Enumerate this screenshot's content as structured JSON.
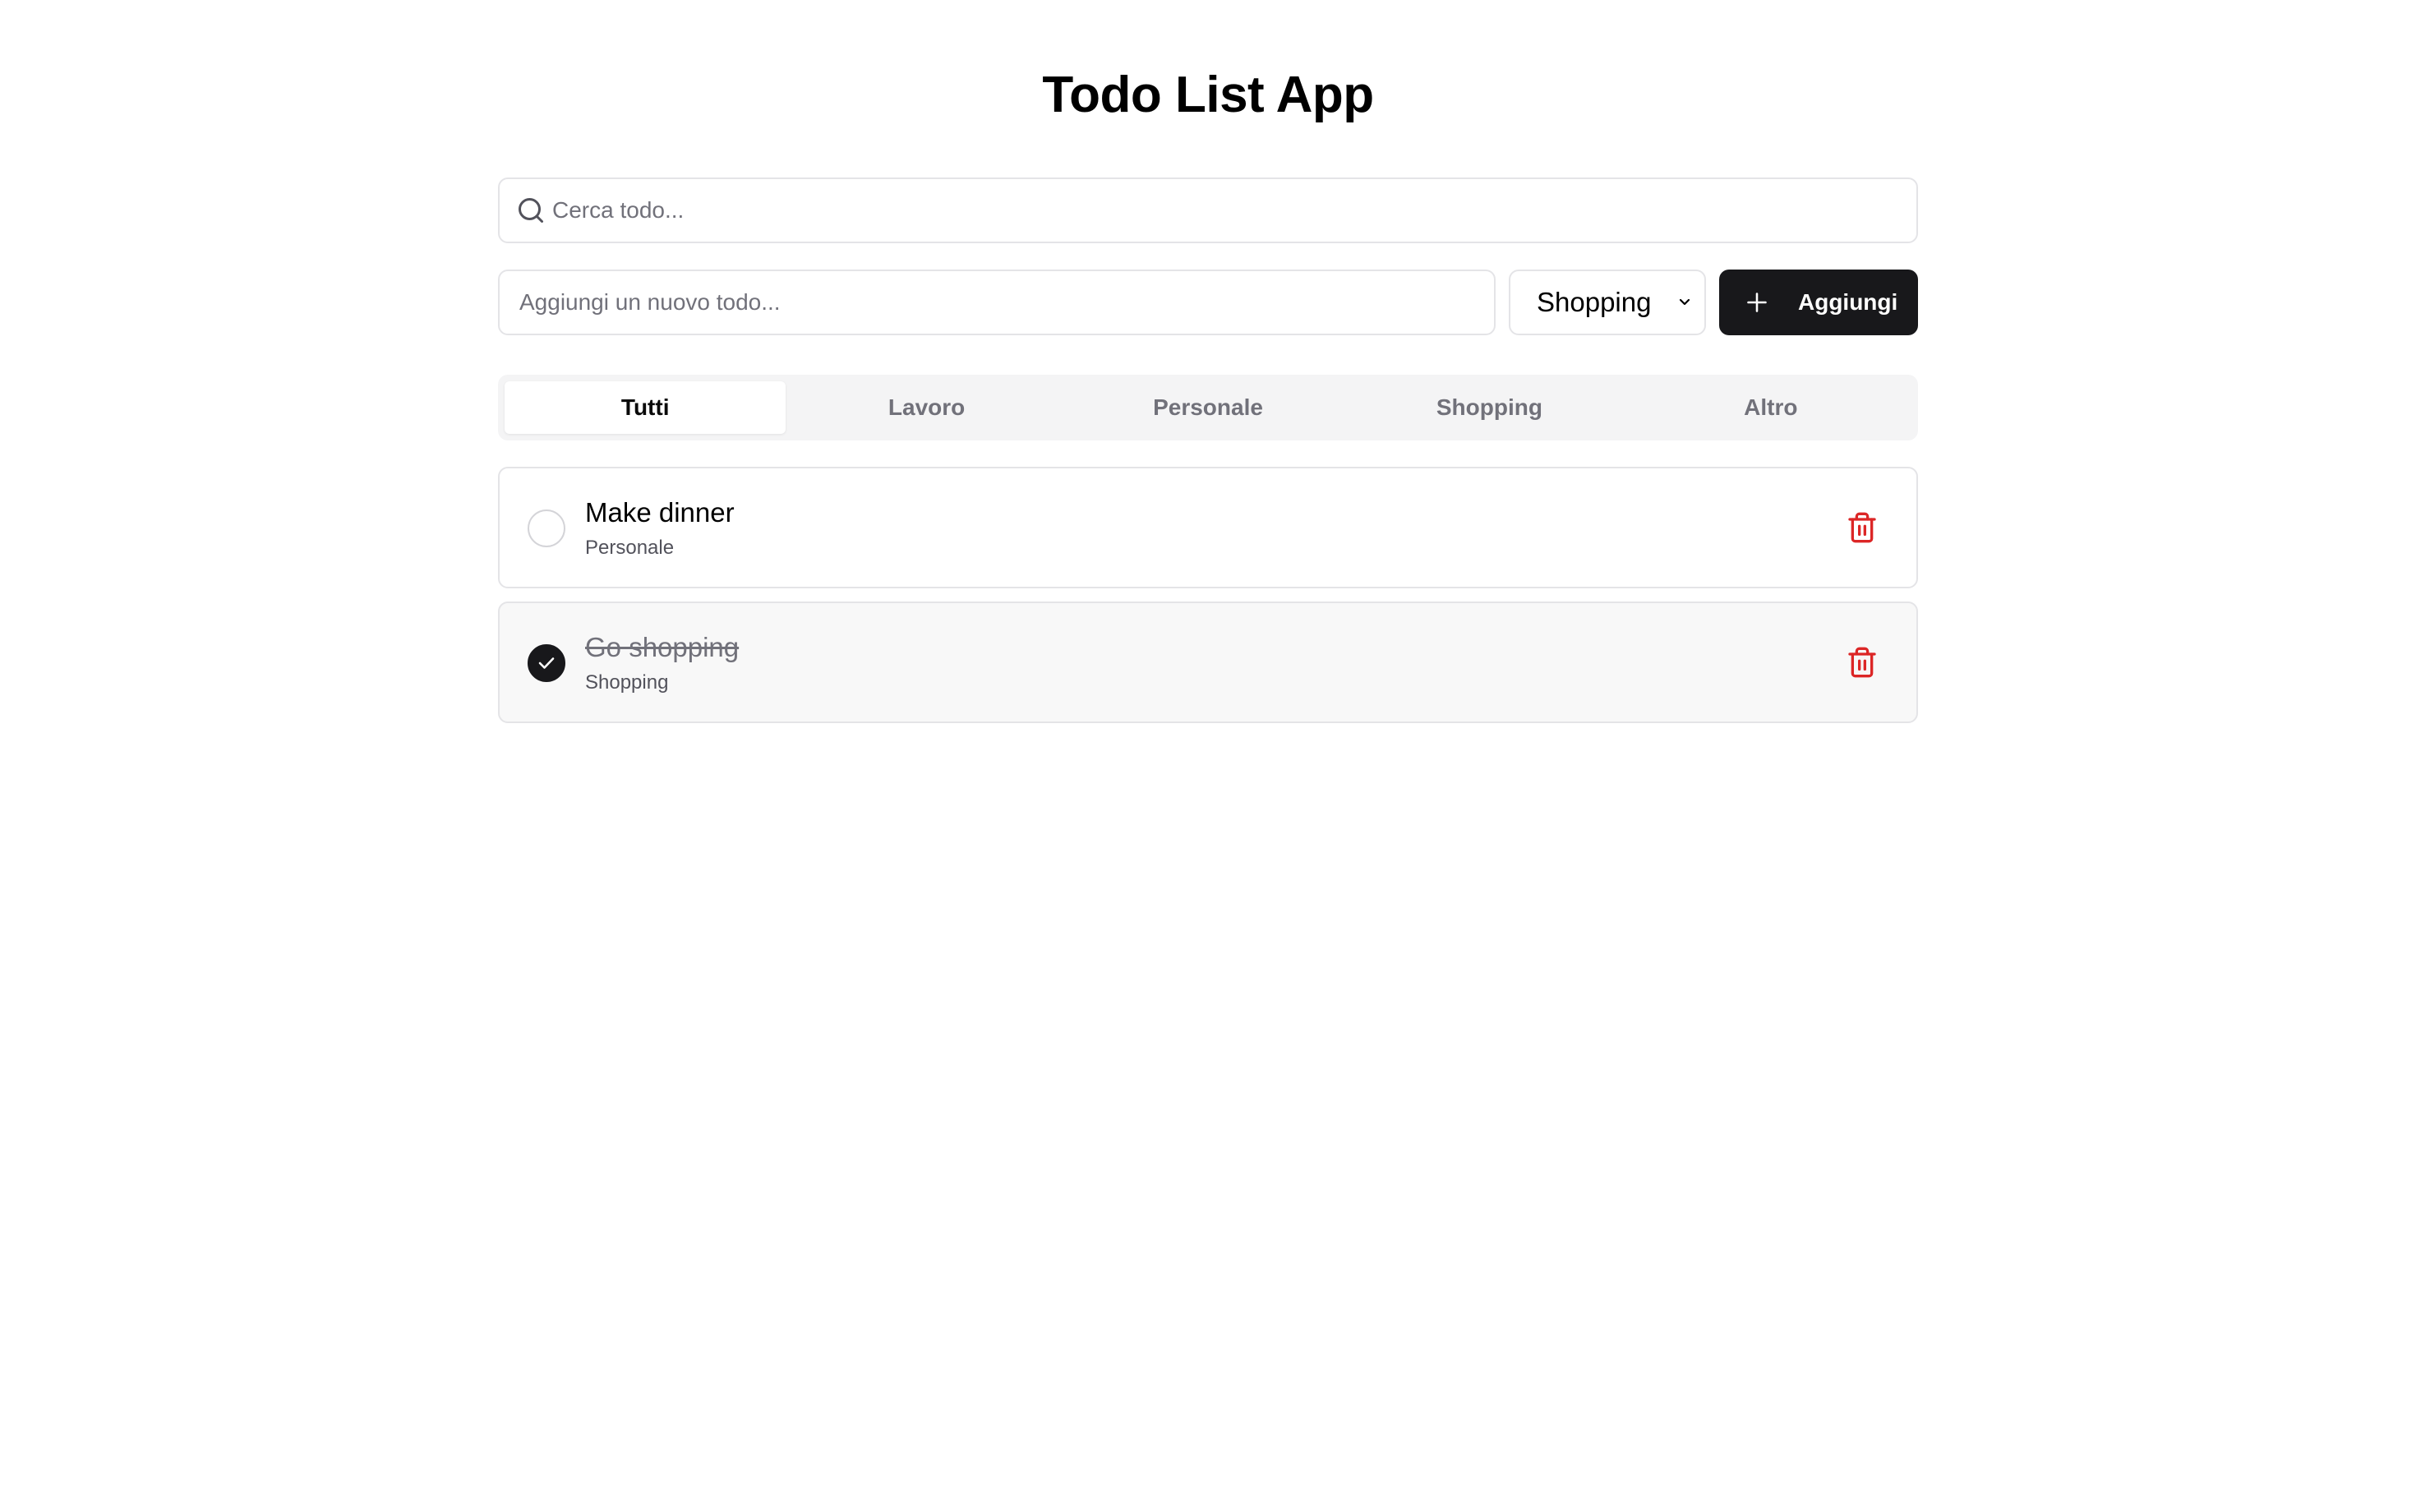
{
  "app": {
    "title": "Todo List App"
  },
  "search": {
    "placeholder": "Cerca todo...",
    "icon": "search-icon"
  },
  "new_todo": {
    "placeholder": "Aggiungi un nuovo todo...",
    "category_selected": "Shopping",
    "add_label": "Aggiungi"
  },
  "tabs": [
    {
      "label": "Tutti",
      "active": true
    },
    {
      "label": "Lavoro",
      "active": false
    },
    {
      "label": "Personale",
      "active": false
    },
    {
      "label": "Shopping",
      "active": false
    },
    {
      "label": "Altro",
      "active": false
    }
  ],
  "todos": [
    {
      "text": "Make dinner",
      "category": "Personale",
      "completed": false
    },
    {
      "text": "Go shopping",
      "category": "Shopping",
      "completed": true
    }
  ],
  "colors": {
    "primary": "#18181b",
    "delete": "#dc2626",
    "muted": "#71717a",
    "border": "#e4e4e7"
  }
}
